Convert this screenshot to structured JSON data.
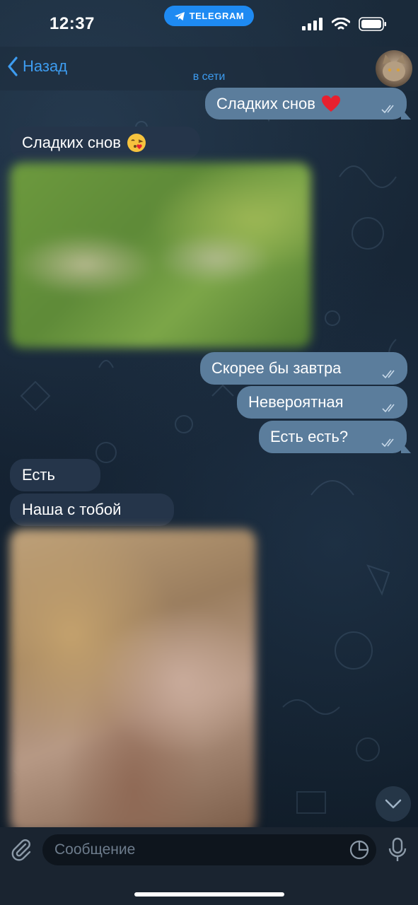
{
  "status_bar": {
    "time": "12:37",
    "app_pill": "TELEGRAM"
  },
  "header": {
    "back_label": "Назад",
    "status": "в сети"
  },
  "messages": [
    {
      "direction": "out",
      "text": "Сладких снов",
      "emoji": "heart"
    },
    {
      "direction": "in",
      "text": "Сладких снов",
      "emoji": "kiss-face"
    },
    {
      "direction": "in",
      "type": "photo"
    },
    {
      "direction": "out",
      "text": "Скорее бы завтра"
    },
    {
      "direction": "out",
      "text": "Невероятная"
    },
    {
      "direction": "out",
      "text": "Есть есть?"
    },
    {
      "direction": "in",
      "text": "Есть"
    },
    {
      "direction": "in",
      "text": "Наша с тобой"
    },
    {
      "direction": "in",
      "type": "photo"
    }
  ],
  "input": {
    "placeholder": "Сообщение"
  },
  "icons": {
    "back": "chevron-left-icon",
    "attach": "paperclip-icon",
    "sticker": "sticker-icon",
    "mic": "microphone-icon",
    "scroll": "chevron-down-icon",
    "read": "double-check-icon"
  },
  "colors": {
    "accent": "#3d9cf0",
    "outgoing_bubble": "#5b7d9c",
    "incoming_bubble": "#25354a",
    "pill": "#1e8af2"
  }
}
